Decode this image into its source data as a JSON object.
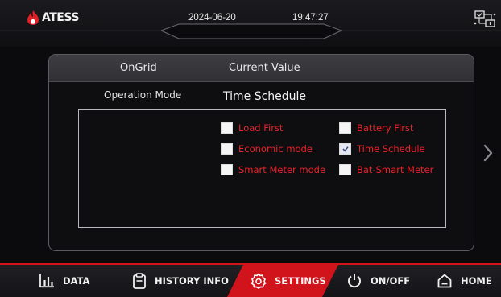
{
  "header": {
    "brand": "ATESS",
    "date": "2024-06-20",
    "time": "19:47:27"
  },
  "panel": {
    "col_header_1": "OnGrid",
    "col_header_2": "Current Value",
    "row_label": "Operation Mode",
    "row_value": "Time Schedule",
    "options": [
      {
        "label": "Load First",
        "checked": false
      },
      {
        "label": "Battery First",
        "checked": false
      },
      {
        "label": "Economic mode",
        "checked": false
      },
      {
        "label": "Time Schedule",
        "checked": true
      },
      {
        "label": "Smart Meter mode",
        "checked": false
      },
      {
        "label": "Bat-Smart Meter",
        "checked": false
      }
    ]
  },
  "nav": {
    "items": [
      {
        "label": "DATA",
        "icon": "bar-chart-icon"
      },
      {
        "label": "HISTORY INFO",
        "icon": "clipboard-icon"
      },
      {
        "label": "SETTINGS",
        "icon": "gear-icon",
        "active": true
      },
      {
        "label": "ON/OFF",
        "icon": "power-icon"
      },
      {
        "label": "HOME",
        "icon": "home-icon"
      }
    ]
  },
  "colors": {
    "accent": "#d1141c",
    "option_text": "#e8232a",
    "background": "#0b0b0e"
  }
}
